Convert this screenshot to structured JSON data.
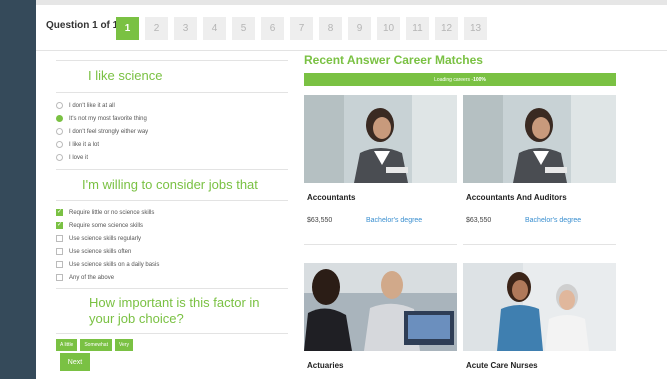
{
  "question": {
    "label": "Question 1 of 13",
    "numbers": [
      "1",
      "2",
      "3",
      "4",
      "5",
      "6",
      "7",
      "8",
      "9",
      "10",
      "11",
      "12",
      "13"
    ],
    "active_index": 0
  },
  "science": {
    "title": "I like science",
    "options": [
      "I don't like it at all",
      "It's not my most favorite thing",
      "I don't feel strongly either way",
      "I like it a lot",
      "I love it"
    ],
    "selected_index": 1
  },
  "jobs": {
    "title": "I'm willing to consider jobs that",
    "options": [
      "Require little or no science skills",
      "Require some science skills",
      "Use science skills regularly",
      "Use science skills often",
      "Use science skills on a daily basis",
      "Any of the above"
    ],
    "checked": [
      true,
      true,
      false,
      false,
      false,
      false
    ]
  },
  "importance": {
    "title_line1": "How important is this factor in",
    "title_line2": "your job choice?",
    "buttons": [
      "A little",
      "Somewhat",
      "Very"
    ]
  },
  "next_label": "Next",
  "matches": {
    "title": "Recent Answer Career Matches",
    "loading_text": "Loading careers - ",
    "loading_pct": "100%",
    "progress_fraction": 1.0,
    "cards": [
      {
        "name": "Accountants",
        "salary": "$63,550",
        "degree": "Bachelor's degree"
      },
      {
        "name": "Accountants And Auditors",
        "salary": "$63,550",
        "degree": "Bachelor's degree"
      },
      {
        "name": "Actuaries"
      },
      {
        "name": "Acute Care Nurses"
      }
    ]
  },
  "colors": {
    "accent": "#7ac143",
    "sidebar": "#354a5a",
    "link": "#3a8fd0"
  }
}
